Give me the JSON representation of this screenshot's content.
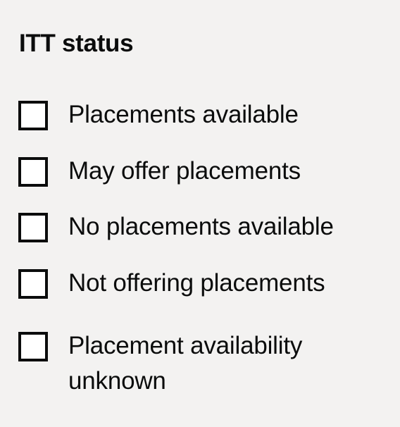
{
  "filter": {
    "legend": "ITT status",
    "options": [
      {
        "label": "Placements available",
        "checked": false
      },
      {
        "label": "May offer placements",
        "checked": false
      },
      {
        "label": "No placements available",
        "checked": false
      },
      {
        "label": "Not offering placements",
        "checked": false
      },
      {
        "label": "Placement availability unknown",
        "checked": false
      }
    ]
  }
}
